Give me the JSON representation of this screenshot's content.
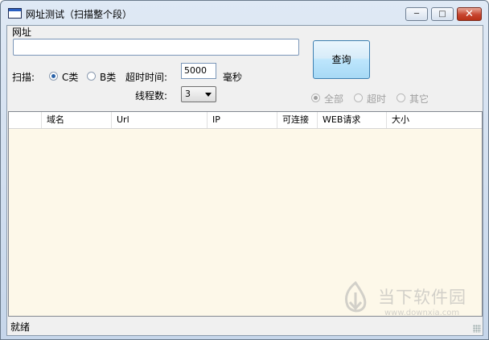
{
  "window": {
    "title": "网址测试（扫描整个段）",
    "minimize_glyph": "─",
    "maximize_glyph": "□",
    "close_glyph": "✕"
  },
  "url": {
    "label": "网址",
    "value": "",
    "placeholder": ""
  },
  "query_button": "查询",
  "scan": {
    "label": "扫描:",
    "options": [
      {
        "label": "C类",
        "selected": true
      },
      {
        "label": "B类",
        "selected": false
      }
    ]
  },
  "timeout": {
    "label": "超时时间:",
    "value": "5000",
    "unit": "毫秒"
  },
  "threads": {
    "label": "线程数:",
    "value": "3"
  },
  "filter": {
    "options": [
      {
        "label": "全部",
        "selected": true
      },
      {
        "label": "超时",
        "selected": false
      },
      {
        "label": "其它",
        "selected": false
      }
    ],
    "disabled": true
  },
  "grid": {
    "columns": [
      "",
      "域名",
      "Url",
      "IP",
      "可连接",
      "WEB请求",
      "大小"
    ]
  },
  "status": "就绪",
  "watermark": {
    "title": "当下软件园",
    "url": "www.downxia.com",
    "icon": "downxia-logo"
  },
  "colors": {
    "grid_bg": "#fdf8e9",
    "accent": "#2a62a8",
    "close_red": "#c7452f"
  }
}
